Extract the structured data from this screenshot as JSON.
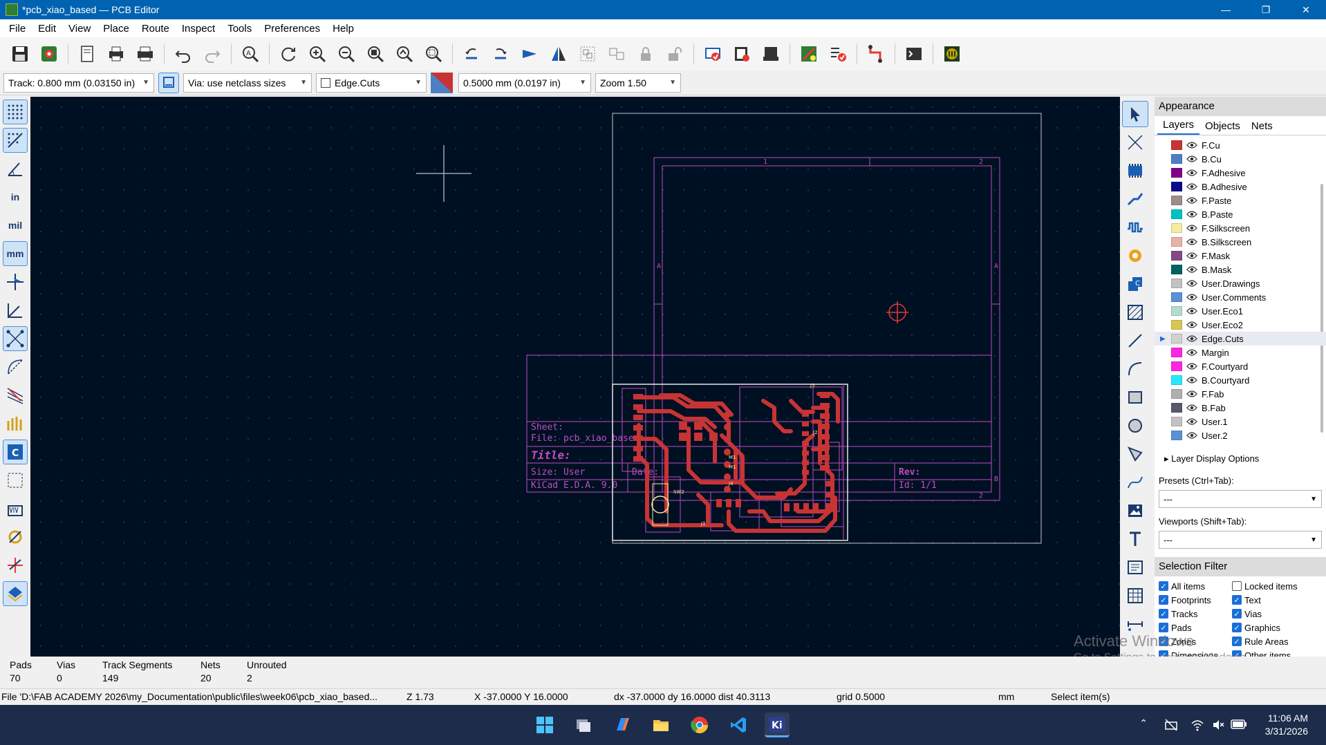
{
  "window": {
    "title": "*pcb_xiao_based — PCB Editor",
    "buttons": [
      "—",
      "❐",
      "✕"
    ]
  },
  "menu": [
    "File",
    "Edit",
    "View",
    "Place",
    "Route",
    "Inspect",
    "Tools",
    "Preferences",
    "Help"
  ],
  "toolbar_icons": [
    "save-icon",
    "board-setup-icon",
    "page-settings-icon",
    "print-icon",
    "plot-icon",
    "undo-icon",
    "redo-icon",
    "find-icon",
    "refresh-icon",
    "zoom-in-icon",
    "zoom-out-icon",
    "zoom-fit-icon",
    "zoom-fit-objects-icon",
    "zoom-selection-icon",
    "rotate-ccw-icon",
    "rotate-cw-icon",
    "flip-icon",
    "mirror-icon",
    "group-icon",
    "ungroup-icon",
    "lock-icon",
    "unlock-icon",
    "update-pcb-icon",
    "footprint-editor-icon",
    "footprint-browser-icon",
    "drc-icon",
    "design-checker-icon",
    "router-icon",
    "scripting-console-icon",
    "plugin-icon"
  ],
  "aux": {
    "track": "Track: 0.800 mm (0.03150 in)",
    "via": "Via: use netclass sizes",
    "layer": "Edge.Cuts",
    "grid": "0.5000 mm (0.0197 in)",
    "zoom": "Zoom 1.50"
  },
  "left_tools": [
    "grid-icon",
    "grid-overrides-icon",
    "polar-coords-icon",
    "in",
    "mil",
    "mm",
    "cursor-shape-icon",
    "measure-axes-icon",
    "ratsnest-icon",
    "curved-ratsnest-icon",
    "hide-ratsnest-icon",
    "pad-outline-icon",
    "board-outline-icon",
    "zone-outline-icon",
    "via-outline-icon",
    "track-outline-icon",
    "net-highlight-icon",
    "layer-color-icon"
  ],
  "right_tools": [
    "select-icon",
    "local-ratsnest-icon",
    "footprint-icon",
    "route-track-icon",
    "tune-length-icon",
    "via-icon",
    "zone-icon",
    "rule-area-icon",
    "line-icon",
    "arc-icon",
    "rectangle-icon",
    "circle-icon",
    "polygon-icon",
    "bezier-icon",
    "image-icon",
    "text-icon",
    "textbox-icon",
    "table-icon",
    "dimension-icon"
  ],
  "appearance": {
    "title": "Appearance",
    "tabs": [
      "Layers",
      "Objects",
      "Nets"
    ],
    "layers": [
      {
        "name": "F.Cu",
        "color": "#c83434"
      },
      {
        "name": "B.Cu",
        "color": "#4d7fc4"
      },
      {
        "name": "F.Adhesive",
        "color": "#84008a"
      },
      {
        "name": "B.Adhesive",
        "color": "#0a0a8a"
      },
      {
        "name": "F.Paste",
        "color": "#9a8f88"
      },
      {
        "name": "B.Paste",
        "color": "#00c2c2"
      },
      {
        "name": "F.Silkscreen",
        "color": "#f2eda1"
      },
      {
        "name": "B.Silkscreen",
        "color": "#e8b2a7"
      },
      {
        "name": "F.Mask",
        "color": "#844a86"
      },
      {
        "name": "B.Mask",
        "color": "#02625f"
      },
      {
        "name": "User.Drawings",
        "color": "#c2c2c2"
      },
      {
        "name": "User.Comments",
        "color": "#5990d8"
      },
      {
        "name": "User.Eco1",
        "color": "#b4dbd2"
      },
      {
        "name": "User.Eco2",
        "color": "#d8c852"
      },
      {
        "name": "Edge.Cuts",
        "color": "#d0d2cd"
      },
      {
        "name": "Margin",
        "color": "#ff26e2"
      },
      {
        "name": "F.Courtyard",
        "color": "#ff26e2"
      },
      {
        "name": "B.Courtyard",
        "color": "#26e9ff"
      },
      {
        "name": "F.Fab",
        "color": "#afafaf"
      },
      {
        "name": "B.Fab",
        "color": "#58596d"
      },
      {
        "name": "User.1",
        "color": "#c2c2c2"
      },
      {
        "name": "User.2",
        "color": "#5990d8"
      }
    ],
    "selected_layer": "Edge.Cuts",
    "layer_display_options": "Layer Display Options",
    "presets_label": "Presets (Ctrl+Tab):",
    "presets_value": "---",
    "viewports_label": "Viewports (Shift+Tab):",
    "viewports_value": "---"
  },
  "selection_filter": {
    "title": "Selection Filter",
    "items": [
      {
        "label": "All items",
        "checked": true
      },
      {
        "label": "Locked items",
        "checked": false
      },
      {
        "label": "Footprints",
        "checked": true
      },
      {
        "label": "Text",
        "checked": true
      },
      {
        "label": "Tracks",
        "checked": true
      },
      {
        "label": "Vias",
        "checked": true
      },
      {
        "label": "Pads",
        "checked": true
      },
      {
        "label": "Graphics",
        "checked": true
      },
      {
        "label": "Zones",
        "checked": true
      },
      {
        "label": "Rule Areas",
        "checked": true
      },
      {
        "label": "Dimensions",
        "checked": true
      },
      {
        "label": "Other items",
        "checked": true
      }
    ]
  },
  "watermark": {
    "line1": "Activate Windows",
    "line2": "Go to Settings to activate Windows."
  },
  "sheet": {
    "sheet_label": "Sheet:",
    "file_label": "File: pcb_xiao_based",
    "title_label": "Title:",
    "size_label": "Size: User",
    "date_label": "Date:",
    "rev_label": "Rev:",
    "kicad_label": "KiCad E.D.A. 9.0",
    "id_label": "Id: 1/1",
    "col1": "1",
    "col2": "2",
    "rowA": "A",
    "rowB": "B"
  },
  "stats": {
    "pads_label": "Pads",
    "pads": "70",
    "vias_label": "Vias",
    "vias": "0",
    "tracks_label": "Track Segments",
    "tracks": "149",
    "nets_label": "Nets",
    "nets": "20",
    "unrouted_label": "Unrouted",
    "unrouted": "2"
  },
  "status": {
    "file": "File 'D:\\FAB ACADEMY 2026\\my_Documentation\\public\\files\\week06\\pcb_xiao_based...",
    "zoom": "Z 1.73",
    "xy": "X -37.0000  Y 16.0000",
    "delta": "dx -37.0000  dy 16.0000  dist 40.3113",
    "grid": "grid 0.5000",
    "units": "mm",
    "mode": "Select item(s)"
  },
  "taskbar": {
    "icons": [
      "start-icon",
      "task-view-icon",
      "copilot-icon",
      "file-explorer-icon",
      "chrome-icon",
      "vscode-icon",
      "kicad-icon"
    ],
    "time": "11:06 AM",
    "date": "3/31/2026"
  }
}
